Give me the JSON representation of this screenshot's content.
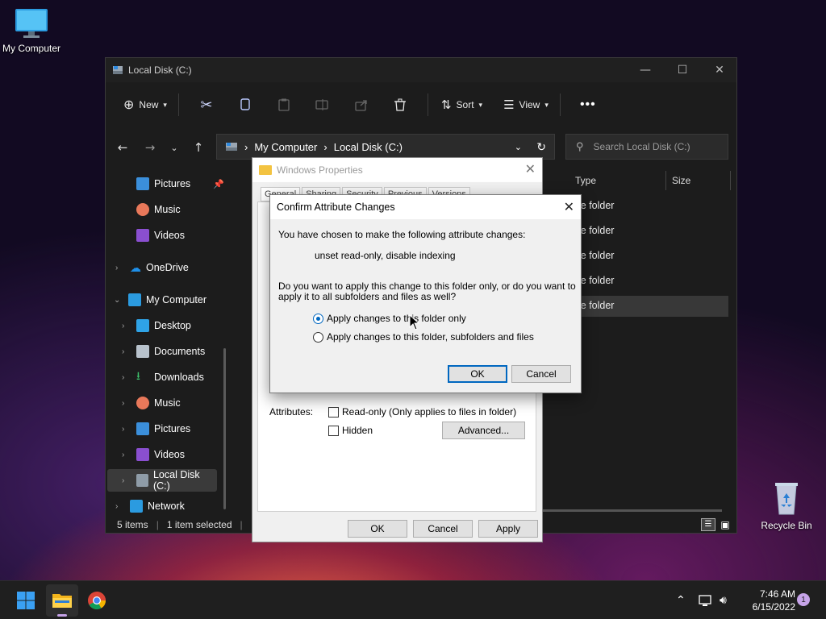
{
  "desktop": {
    "my_computer_label": "My Computer",
    "recycle_bin_label": "Recycle Bin"
  },
  "explorer": {
    "title": "Local Disk (C:)",
    "toolbar": {
      "new_label": "New",
      "sort_label": "Sort",
      "view_label": "View"
    },
    "address": {
      "segments": [
        "My Computer",
        "Local Disk (C:)"
      ]
    },
    "search_placeholder": "Search Local Disk (C:)",
    "nav": {
      "quick": [
        "Pictures",
        "Music",
        "Videos"
      ],
      "onedrive": "OneDrive",
      "my_computer": "My Computer",
      "children": [
        "Desktop",
        "Documents",
        "Downloads",
        "Music",
        "Pictures",
        "Videos",
        "Local Disk (C:)"
      ],
      "network": "Network"
    },
    "columns": {
      "type": "Type",
      "size": "Size"
    },
    "rows_type": [
      "le folder",
      "le folder",
      "le folder",
      "le folder",
      "le folder"
    ],
    "status": {
      "items": "5 items",
      "selected": "1 item selected"
    }
  },
  "properties": {
    "title": "Windows Properties",
    "tabs": [
      "General",
      "Sharing",
      "Security",
      "Previous",
      "Versions"
    ],
    "attributes_label": "Attributes:",
    "readonly_label": "Read-only (Only applies to files in folder)",
    "hidden_label": "Hidden",
    "advanced_label": "Advanced...",
    "ok_label": "OK",
    "cancel_label": "Cancel",
    "apply_label": "Apply"
  },
  "confirm": {
    "title": "Confirm Attribute Changes",
    "intro": "You have chosen to make the following attribute changes:",
    "changes": "unset read-only, disable indexing",
    "question_line1": "Do you want to apply this change to this folder only, or do you want to",
    "question_line2": "apply it to all subfolders and files as well?",
    "option_folder_only": "Apply changes to this folder only",
    "option_all": "Apply changes to this folder, subfolders and files",
    "selected_option": "folder_only",
    "ok_label": "OK",
    "cancel_label": "Cancel"
  },
  "taskbar": {
    "time": "7:46 AM",
    "date": "6/15/2022",
    "notifications": "1"
  }
}
